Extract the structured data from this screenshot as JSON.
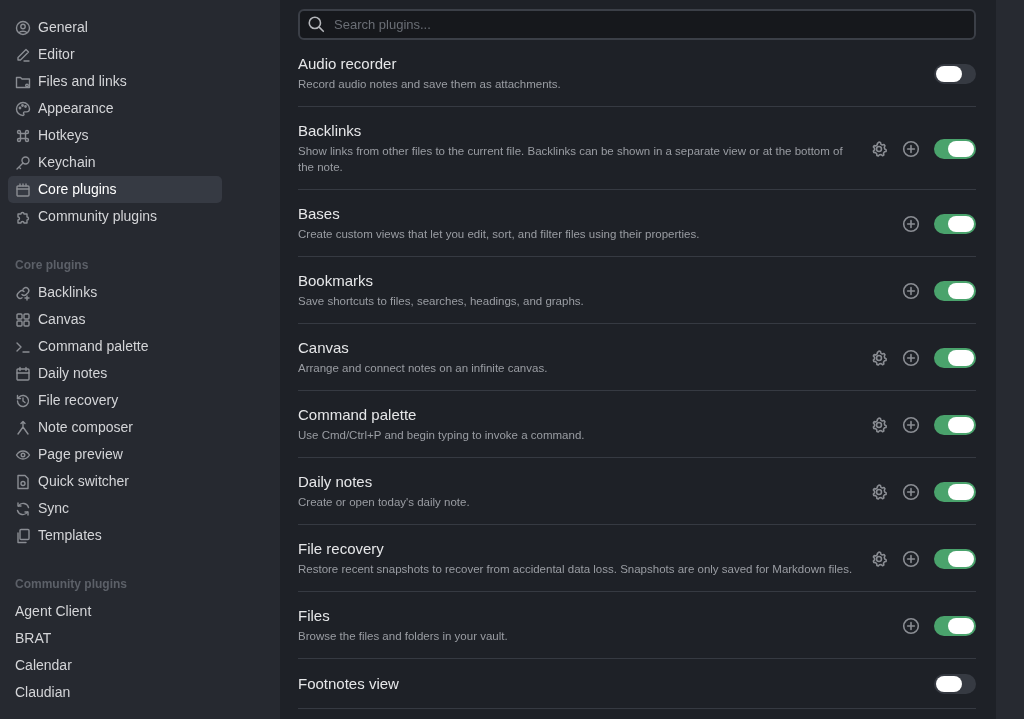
{
  "sidebar": {
    "sections": [
      {
        "items": [
          {
            "label": "General",
            "selected": false
          },
          {
            "label": "Editor",
            "selected": false
          },
          {
            "label": "Files and links",
            "selected": false
          },
          {
            "label": "Appearance",
            "selected": false
          },
          {
            "label": "Hotkeys",
            "selected": false
          },
          {
            "label": "Keychain",
            "selected": false
          },
          {
            "label": "Core plugins",
            "selected": true
          },
          {
            "label": "Community plugins",
            "selected": false
          }
        ]
      },
      {
        "title": "Core plugins",
        "items": [
          {
            "label": "Backlinks",
            "selected": false
          },
          {
            "label": "Canvas",
            "selected": false
          },
          {
            "label": "Command palette",
            "selected": false
          },
          {
            "label": "Daily notes",
            "selected": false
          },
          {
            "label": "File recovery",
            "selected": false
          },
          {
            "label": "Note composer",
            "selected": false
          },
          {
            "label": "Page preview",
            "selected": false
          },
          {
            "label": "Quick switcher",
            "selected": false
          },
          {
            "label": "Sync",
            "selected": false
          },
          {
            "label": "Templates",
            "selected": false
          }
        ]
      },
      {
        "title": "Community plugins",
        "items": [
          {
            "label": "Agent Client",
            "selected": false
          },
          {
            "label": "BRAT",
            "selected": false
          },
          {
            "label": "Calendar",
            "selected": false
          },
          {
            "label": "Claudian",
            "selected": false
          }
        ]
      }
    ]
  },
  "search": {
    "placeholder": "Search plugins..."
  },
  "plugins": [
    {
      "name": "Audio recorder",
      "description": "Record audio notes and save them as attachments.",
      "settings": false,
      "hotkeys": false,
      "on": false
    },
    {
      "name": "Backlinks",
      "description": "Show links from other files to the current file. Backlinks can be shown in a separate view or at the bottom of the note.",
      "settings": true,
      "hotkeys": true,
      "on": true
    },
    {
      "name": "Bases",
      "description": "Create custom views that let you edit, sort, and filter files using their properties.",
      "settings": false,
      "hotkeys": true,
      "on": true
    },
    {
      "name": "Bookmarks",
      "description": "Save shortcuts to files, searches, headings, and graphs.",
      "settings": false,
      "hotkeys": true,
      "on": true
    },
    {
      "name": "Canvas",
      "description": "Arrange and connect notes on an infinite canvas.",
      "settings": true,
      "hotkeys": true,
      "on": true
    },
    {
      "name": "Command palette",
      "description": "Use Cmd/Ctrl+P and begin typing to invoke a command.",
      "settings": true,
      "hotkeys": true,
      "on": true
    },
    {
      "name": "Daily notes",
      "description": "Create or open today's daily note.",
      "settings": true,
      "hotkeys": true,
      "on": true
    },
    {
      "name": "File recovery",
      "description": "Restore recent snapshots to recover from accidental data loss. Snapshots are only saved for Markdown files.",
      "settings": true,
      "hotkeys": true,
      "on": true
    },
    {
      "name": "Files",
      "description": "Browse the files and folders in your vault.",
      "settings": false,
      "hotkeys": true,
      "on": true
    },
    {
      "name": "Footnotes view",
      "settings": false,
      "hotkeys": false,
      "on": false
    }
  ]
}
